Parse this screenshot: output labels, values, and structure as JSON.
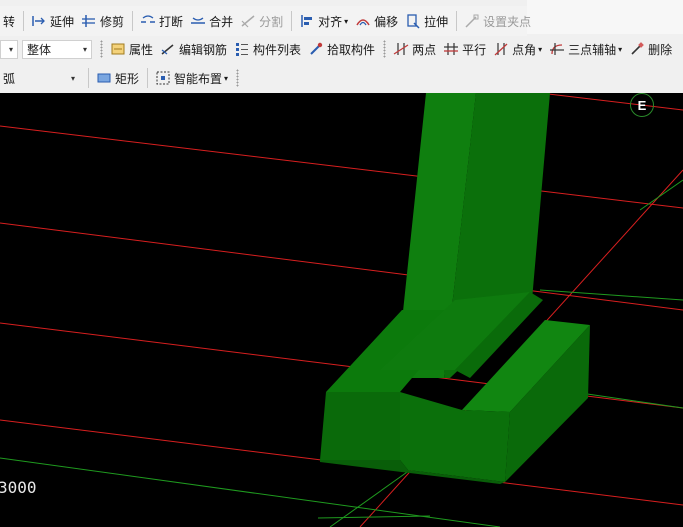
{
  "toolbar1": {
    "rotate_partial": "转",
    "extend": "延伸",
    "trim": "修剪",
    "break": "打断",
    "merge": "合并",
    "split": "分割",
    "align": "对齐",
    "offset": "偏移",
    "stretch": "拉伸",
    "set_grip": "设置夹点"
  },
  "toolbar2": {
    "floor_select_value": "",
    "scope_select_value": "整体",
    "properties": "属性",
    "edit_rebar": "编辑钢筋",
    "component_list": "构件列表",
    "pick_component": "拾取构件",
    "two_points": "两点",
    "parallel": "平行",
    "point_angle": "点角",
    "three_point_axis": "三点辅轴",
    "delete_partial": "删除"
  },
  "toolbar3": {
    "arc_partial": "弧",
    "arc_select_value": "",
    "rectangle": "矩形",
    "smart_place": "智能布置"
  },
  "viewport": {
    "coord_text": "3000",
    "compass_letter": "E",
    "colors": {
      "background": "#000000",
      "axis_red": "#d81f1f",
      "grid_green": "#1f9a1f",
      "solid_front": "#0a6f0a",
      "solid_light": "#0c7a0c",
      "solid_top": "#118611"
    }
  }
}
